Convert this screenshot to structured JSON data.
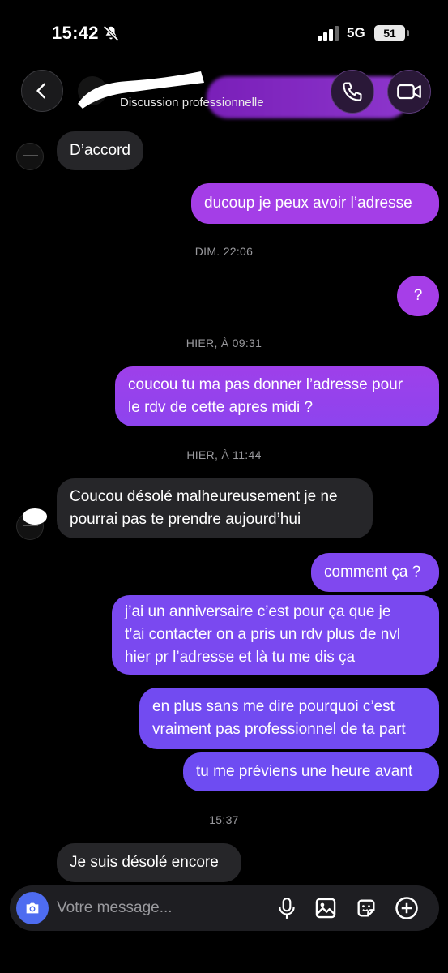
{
  "status_bar": {
    "time": "15:42",
    "network": "5G",
    "battery": "51"
  },
  "header": {
    "subtitle": "Discussion professionnelle"
  },
  "messages": [
    {
      "kind": "in",
      "text": "D’accord"
    },
    {
      "kind": "out",
      "text": "ducoup je peux avoir l’adresse"
    },
    {
      "kind": "time",
      "text": "DIM. 22:06"
    },
    {
      "kind": "out",
      "text": "?"
    },
    {
      "kind": "time",
      "text": "HIER, À 09:31"
    },
    {
      "kind": "out",
      "line1": "coucou tu ma pas donner l’adresse pour",
      "line2": "le rdv de cette apres midi ?"
    },
    {
      "kind": "time",
      "text": "HIER, À 11:44"
    },
    {
      "kind": "in",
      "line1": "Coucou désolé malheureusement je ne",
      "line2": "pourrai pas te prendre aujourd’hui"
    },
    {
      "kind": "out",
      "text": "comment ça ?"
    },
    {
      "kind": "out",
      "line1": "j’ai un anniversaire c’est pour ça que je",
      "line2": "t’ai contacter on a pris un rdv plus de nvl",
      "line3": "hier pr l’adresse et là tu me dis ça"
    },
    {
      "kind": "out",
      "line1": "en plus sans me dire pourquoi c’est",
      "line2": "vraiment pas professionnel de ta part"
    },
    {
      "kind": "out",
      "text": "tu me préviens une heure avant"
    },
    {
      "kind": "time",
      "text": "15:37"
    },
    {
      "kind": "in",
      "text": "Je suis désolé encore"
    }
  ],
  "composer": {
    "placeholder": "Votre message..."
  },
  "icons": {
    "back": "chevron-left-icon",
    "call": "phone-icon",
    "video": "video-camera-icon",
    "camera": "camera-icon",
    "mic": "microphone-icon",
    "gallery": "image-icon",
    "sticker": "sticker-icon",
    "add": "plus-circle-icon"
  },
  "colors": {
    "outgoing_top": "#a83fe6",
    "outgoing_bottom": "#6e4bf2",
    "incoming": "#262629",
    "camera_button": "#4e6cf0"
  }
}
